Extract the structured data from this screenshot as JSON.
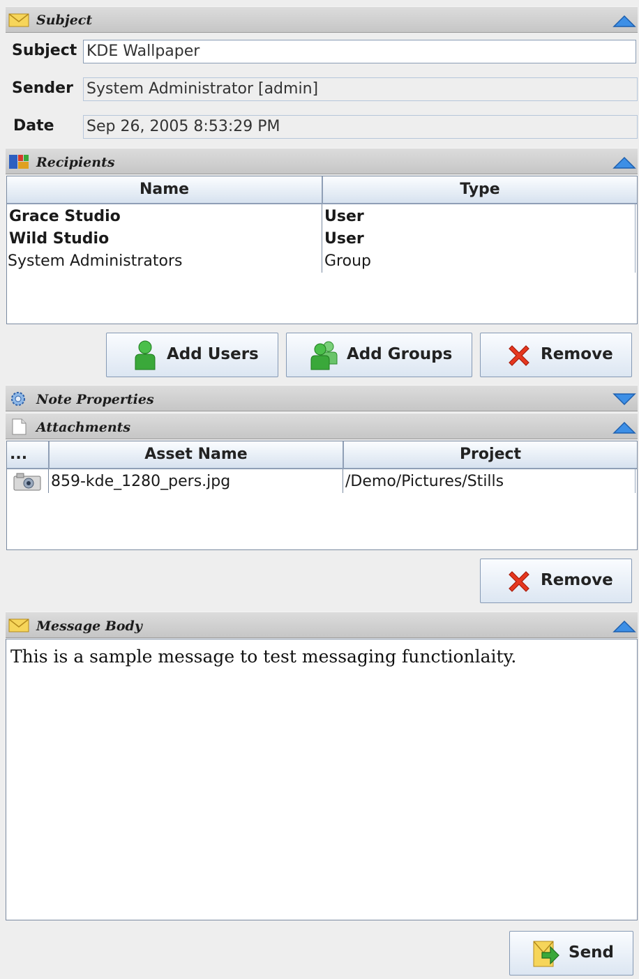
{
  "sections": {
    "subject": {
      "title": "Subject"
    },
    "recipients": {
      "title": "Recipients"
    },
    "note_properties": {
      "title": "Note Properties"
    },
    "attachments": {
      "title": "Attachments"
    },
    "message_body": {
      "title": "Message Body"
    }
  },
  "fields": {
    "subject": {
      "label": "Subject",
      "value": "KDE Wallpaper"
    },
    "sender": {
      "label": "Sender",
      "value": "System Administrator [admin]"
    },
    "date": {
      "label": "Date",
      "value": "Sep 26, 2005 8:53:29 PM"
    }
  },
  "recipients_table": {
    "headers": [
      "Name",
      "Type"
    ],
    "rows": [
      {
        "name": "Grace Studio",
        "type": "User"
      },
      {
        "name": "Wild Studio",
        "type": "User"
      },
      {
        "name": "System Administrators",
        "type": "Group"
      }
    ]
  },
  "recipient_buttons": {
    "add_users": "Add Users",
    "add_groups": "Add Groups",
    "remove": "Remove"
  },
  "attachments_table": {
    "headers": [
      "...",
      "Asset Name",
      "Project"
    ],
    "rows": [
      {
        "icon": "image-icon",
        "asset_name": "859-kde_1280_pers.jpg",
        "project": "/Demo/Pictures/Stills"
      }
    ]
  },
  "attachment_buttons": {
    "remove": "Remove"
  },
  "message": {
    "body": "This is a sample message to test messaging functionlaity."
  },
  "footer": {
    "send": "Send"
  },
  "colors": {
    "accent_blue": "#2f7fd8",
    "header_gray": "#c8c8c8",
    "remove_red": "#e0321e",
    "user_green": "#3aa83a"
  }
}
